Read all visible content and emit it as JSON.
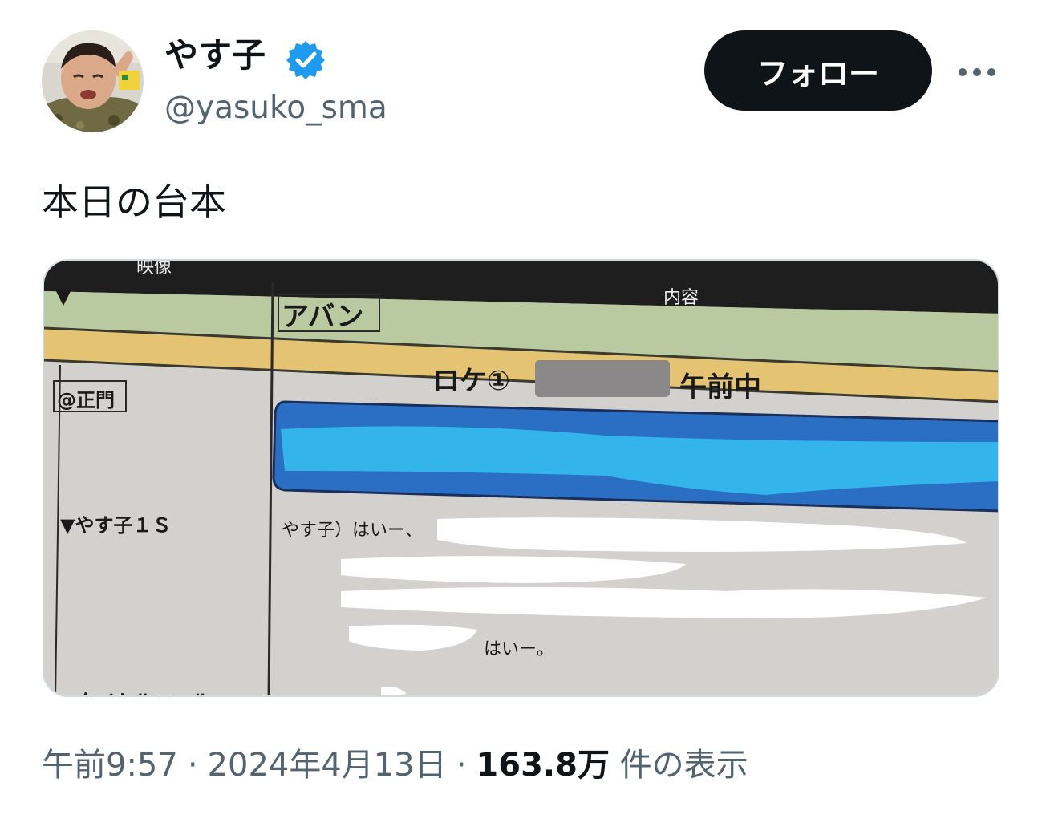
{
  "user": {
    "display_name": "やす子",
    "handle": "@yasuko_sma",
    "verified_icon": "verified-badge-icon",
    "avatar_icon": "avatar"
  },
  "actions": {
    "follow_label": "フォロー",
    "more_icon": "more-options-icon"
  },
  "tweet": {
    "text": "本日の台本"
  },
  "media": {
    "header_left": "映像",
    "header_right": "内容",
    "marker": "▼",
    "scene_label": "アバン",
    "location_band": "ロケ①",
    "location_time": "午前中",
    "location_cell": "@正門",
    "row1_label": "▼やす子１Ｓ",
    "row2_label": "▼タイトルコール",
    "line1": "やす子）はいー、",
    "line2": "はいー。"
  },
  "meta": {
    "time": "午前9:57",
    "dot1": "·",
    "date": "2024年4月13日",
    "dot2": "·",
    "views": "163.8万",
    "views_suffix": "件の表示"
  },
  "colors": {
    "text_primary": "#0f1419",
    "text_secondary": "#536471",
    "verified_blue": "#1d9bf0",
    "button_bg": "#0f1419",
    "script_green": "#b9c9a0",
    "script_yellow": "#e4c373",
    "script_blue": "#2a6fc4",
    "redact_cyan": "#33b5ec"
  }
}
